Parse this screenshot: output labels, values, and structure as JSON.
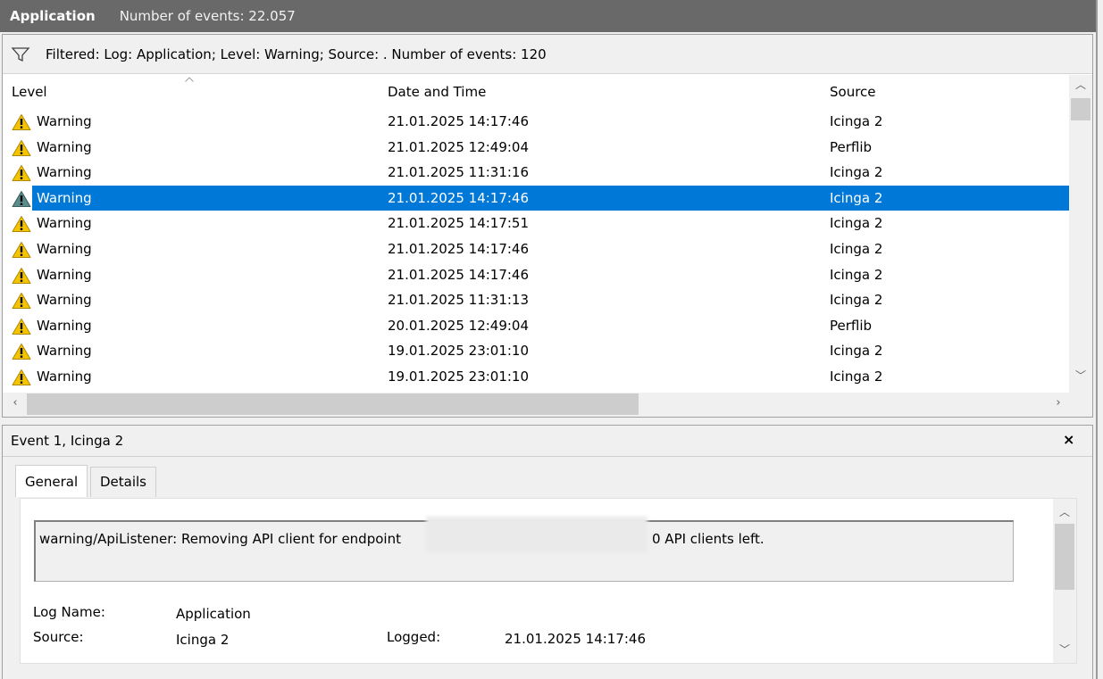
{
  "header": {
    "app_name": "Application",
    "event_count": "Number of events: 22.057"
  },
  "filter": {
    "icon": "filter-icon",
    "text": "Filtered: Log: Application; Level: Warning; Source: . Number of events: 120"
  },
  "columns": {
    "level": "Level",
    "datetime": "Date and Time",
    "source": "Source"
  },
  "rows": [
    {
      "level": "Warning",
      "datetime": "21.01.2025 14:17:46",
      "source": "Icinga 2"
    },
    {
      "level": "Warning",
      "datetime": "21.01.2025 12:49:04",
      "source": "Perflib"
    },
    {
      "level": "Warning",
      "datetime": "21.01.2025 11:31:16",
      "source": "Icinga 2"
    },
    {
      "level": "Warning",
      "datetime": "21.01.2025 14:17:46",
      "source": "Icinga 2",
      "selected": true
    },
    {
      "level": "Warning",
      "datetime": "21.01.2025 14:17:51",
      "source": "Icinga 2"
    },
    {
      "level": "Warning",
      "datetime": "21.01.2025 14:17:46",
      "source": "Icinga 2"
    },
    {
      "level": "Warning",
      "datetime": "21.01.2025 14:17:46",
      "source": "Icinga 2"
    },
    {
      "level": "Warning",
      "datetime": "21.01.2025 11:31:13",
      "source": "Icinga 2"
    },
    {
      "level": "Warning",
      "datetime": "20.01.2025 12:49:04",
      "source": "Perflib"
    },
    {
      "level": "Warning",
      "datetime": "19.01.2025 23:01:10",
      "source": "Icinga 2"
    },
    {
      "level": "Warning",
      "datetime": "19.01.2025 23:01:10",
      "source": "Icinga 2"
    }
  ],
  "details": {
    "title": "Event 1, Icinga 2",
    "close": "×",
    "tabs": [
      "General",
      "Details"
    ],
    "message_before": "warning/ApiListener: Removing API client for endpoint",
    "message_after": "0 API clients left.",
    "log_name_label": "Log Name:",
    "log_name_value": "Application",
    "source_label": "Source:",
    "source_value": "Icinga 2",
    "logged_label": "Logged:",
    "logged_value": "21.01.2025 14:17:46"
  },
  "colors": {
    "title_bar": "#696969",
    "selection": "#0078d7",
    "warning_icon": "#f5c400"
  }
}
